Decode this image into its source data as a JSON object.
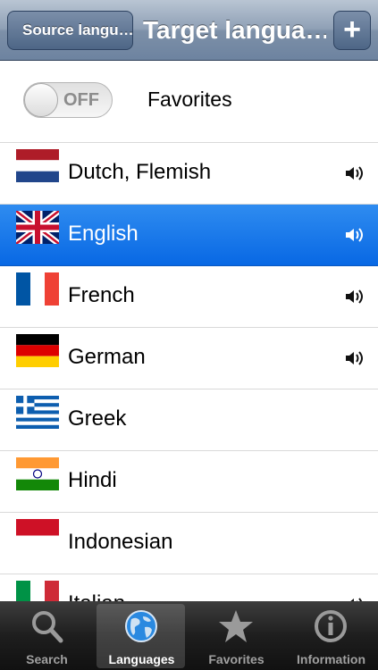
{
  "nav": {
    "back_label": "Source langu…",
    "title": "Target langua…",
    "add_label": "+"
  },
  "favorites_row": {
    "toggle_state": "OFF",
    "label": "Favorites"
  },
  "languages": [
    {
      "name": "Dutch, Flemish",
      "flag": "netherlands-flag",
      "audio": true,
      "selected": false
    },
    {
      "name": "English",
      "flag": "uk-flag",
      "audio": true,
      "selected": true
    },
    {
      "name": "French",
      "flag": "france-flag",
      "audio": true,
      "selected": false
    },
    {
      "name": "German",
      "flag": "germany-flag",
      "audio": true,
      "selected": false
    },
    {
      "name": "Greek",
      "flag": "greece-flag",
      "audio": false,
      "selected": false
    },
    {
      "name": "Hindi",
      "flag": "india-flag",
      "audio": false,
      "selected": false
    },
    {
      "name": "Indonesian",
      "flag": "indonesia-flag",
      "audio": false,
      "selected": false
    },
    {
      "name": "Italian",
      "flag": "italy-flag",
      "audio": true,
      "selected": false
    }
  ],
  "tabs": [
    {
      "label": "Search",
      "icon": "search-icon",
      "active": false
    },
    {
      "label": "Languages",
      "icon": "globe-icon",
      "active": true
    },
    {
      "label": "Favorites",
      "icon": "star-icon",
      "active": false
    },
    {
      "label": "Information",
      "icon": "info-icon",
      "active": false
    }
  ],
  "colors": {
    "selection": "#0a6ae6",
    "nav": "#7d90a8"
  }
}
